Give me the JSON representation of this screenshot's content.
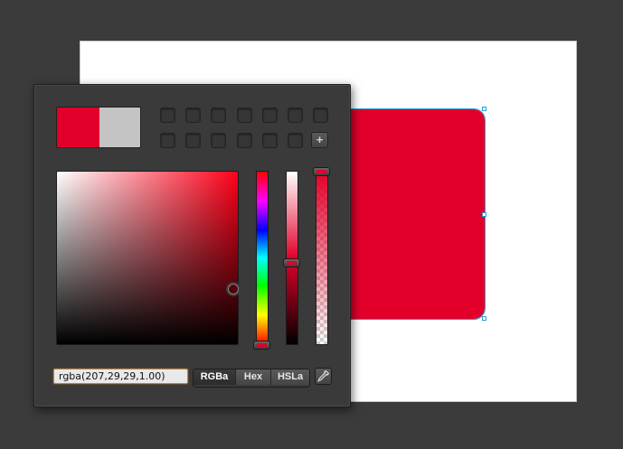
{
  "canvas": {
    "background": "#3b3b3b",
    "artboard_color": "#ffffff",
    "shape_fill": "#e2002a",
    "selection_color": "#2a9fd6"
  },
  "picker": {
    "current_color": "#e2002a",
    "previous_color": "#c4c4c4",
    "swatch_count": 14,
    "add_swatch_label": "+",
    "color_value": "rgba(207,29,29,1.00)",
    "modes": [
      {
        "label": "RGBa",
        "active": true
      },
      {
        "label": "Hex",
        "active": false
      },
      {
        "label": "HSLa",
        "active": false
      }
    ],
    "hue_fraction": 1.0,
    "lightness_fraction": 0.5,
    "alpha": 1.0
  }
}
